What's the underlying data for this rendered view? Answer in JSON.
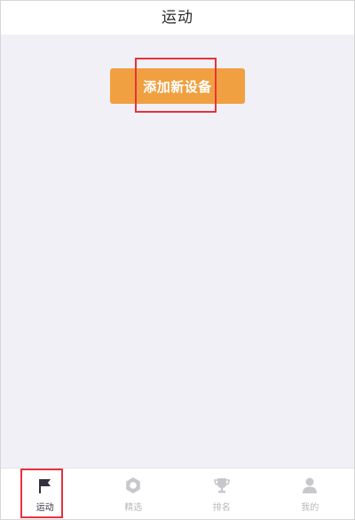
{
  "header": {
    "title": "运动"
  },
  "main": {
    "add_device_label": "添加新设备"
  },
  "tabbar": {
    "tabs": [
      {
        "label": "运动",
        "icon": "flag-icon",
        "active": true
      },
      {
        "label": "精选",
        "icon": "badge-icon",
        "active": false
      },
      {
        "label": "排名",
        "icon": "trophy-icon",
        "active": false
      },
      {
        "label": "我的",
        "icon": "user-icon",
        "active": false
      }
    ]
  },
  "colors": {
    "accent": "#f0a040",
    "highlight": "#e8323c",
    "background": "#f1f0f6",
    "active_tab": "#333340",
    "inactive_tab": "#b9b9bd"
  }
}
